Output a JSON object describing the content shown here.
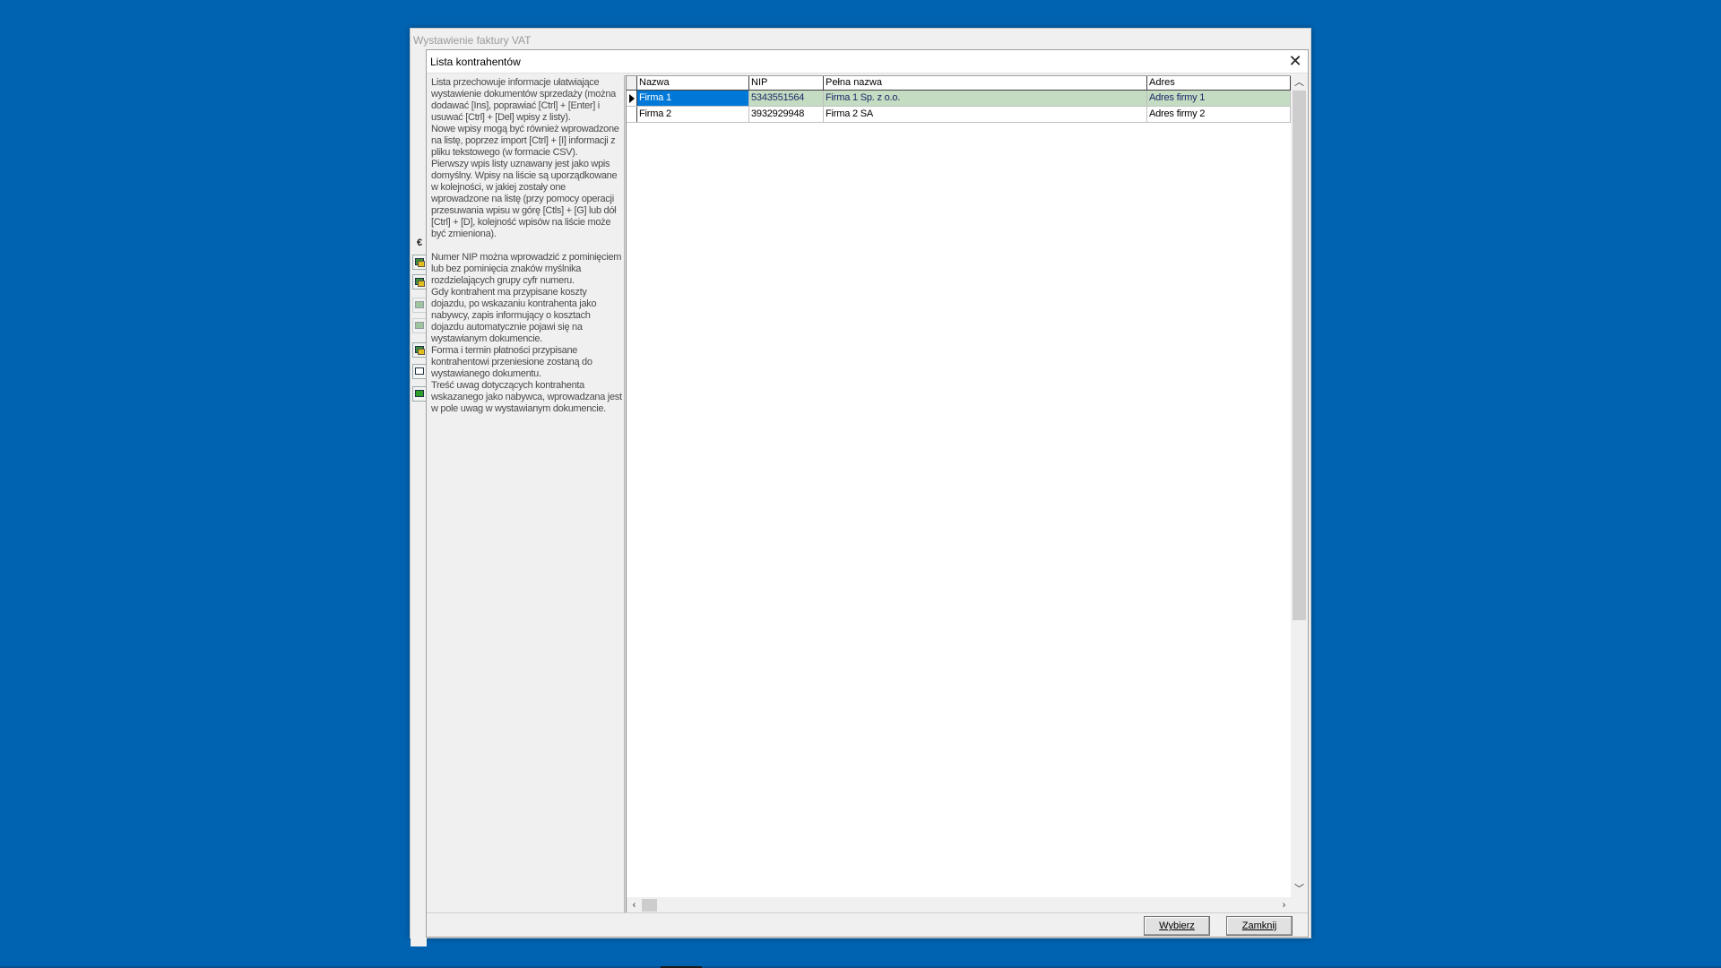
{
  "parent_window": {
    "title": "Wystawienie faktury VAT"
  },
  "left_toolbar": {
    "icons": [
      {
        "name": "euro-icon",
        "glyph": "€"
      },
      {
        "name": "add-record-icon"
      },
      {
        "name": "edit-record-icon"
      },
      {
        "name": "copy-record-icon"
      },
      {
        "name": "back-record-icon"
      },
      {
        "name": "print-icon"
      },
      {
        "name": "table-icon"
      },
      {
        "name": "export-icon"
      }
    ]
  },
  "dialog": {
    "title": "Lista kontrahentów",
    "close_glyph": "✕",
    "info": {
      "paragraphs": [
        "Lista przechowuje informacje ułatwiające wystawienie dokumentów sprzedaży (można dodawać [Ins], poprawiać [Ctrl] + [Enter] i usuwać [Ctrl] + [Del] wpisy z listy).",
        "Nowe wpisy mogą być również wprowadzone na listę, poprzez import [Ctrl] + [I] informacji z pliku tekstowego (w formacie CSV).",
        "Pierwszy wpis listy uznawany jest jako wpis domyślny. Wpisy na liście są uporządkowane w kolejności, w jakiej zostały one wprowadzone na listę (przy pomocy operacji przesuwania wpisu w górę [Ctls] + [G] lub dół [Ctrl] + [D], kolejność wpisów na liście może być zmieniona).",
        "",
        "Numer NIP można wprowadzić z pominięciem lub bez pominięcia znaków myślnika rozdzielających grupy cyfr numeru.",
        "Gdy kontrahent ma przypisane koszty dojazdu, po wskazaniu kontrahenta jako nabywcy, zapis informujący o kosztach dojazdu automatycznie pojawi się na wystawianym dokumencie.",
        "Forma i termin płatności przypisane kontrahentowi przeniesione zostaną do wystawianego dokumentu.",
        "Treść uwag dotyczących kontrahenta wskazanego jako nabywca, wprowadzana jest w pole uwag w wystawianym dokumencie."
      ]
    },
    "table": {
      "columns": [
        "Nazwa",
        "NIP",
        "Pełna nazwa",
        "Adres"
      ],
      "rows": [
        [
          "Firma 1",
          "5343551564",
          "Firma 1 Sp. z o.o.",
          "Adres firmy 1"
        ],
        [
          "Firma 2",
          "3932929948",
          "Firma 2 SA",
          "Adres firmy 2"
        ]
      ],
      "selected_row": 0
    },
    "buttons": {
      "select": "Wybierz",
      "close": "Zamknij"
    }
  }
}
